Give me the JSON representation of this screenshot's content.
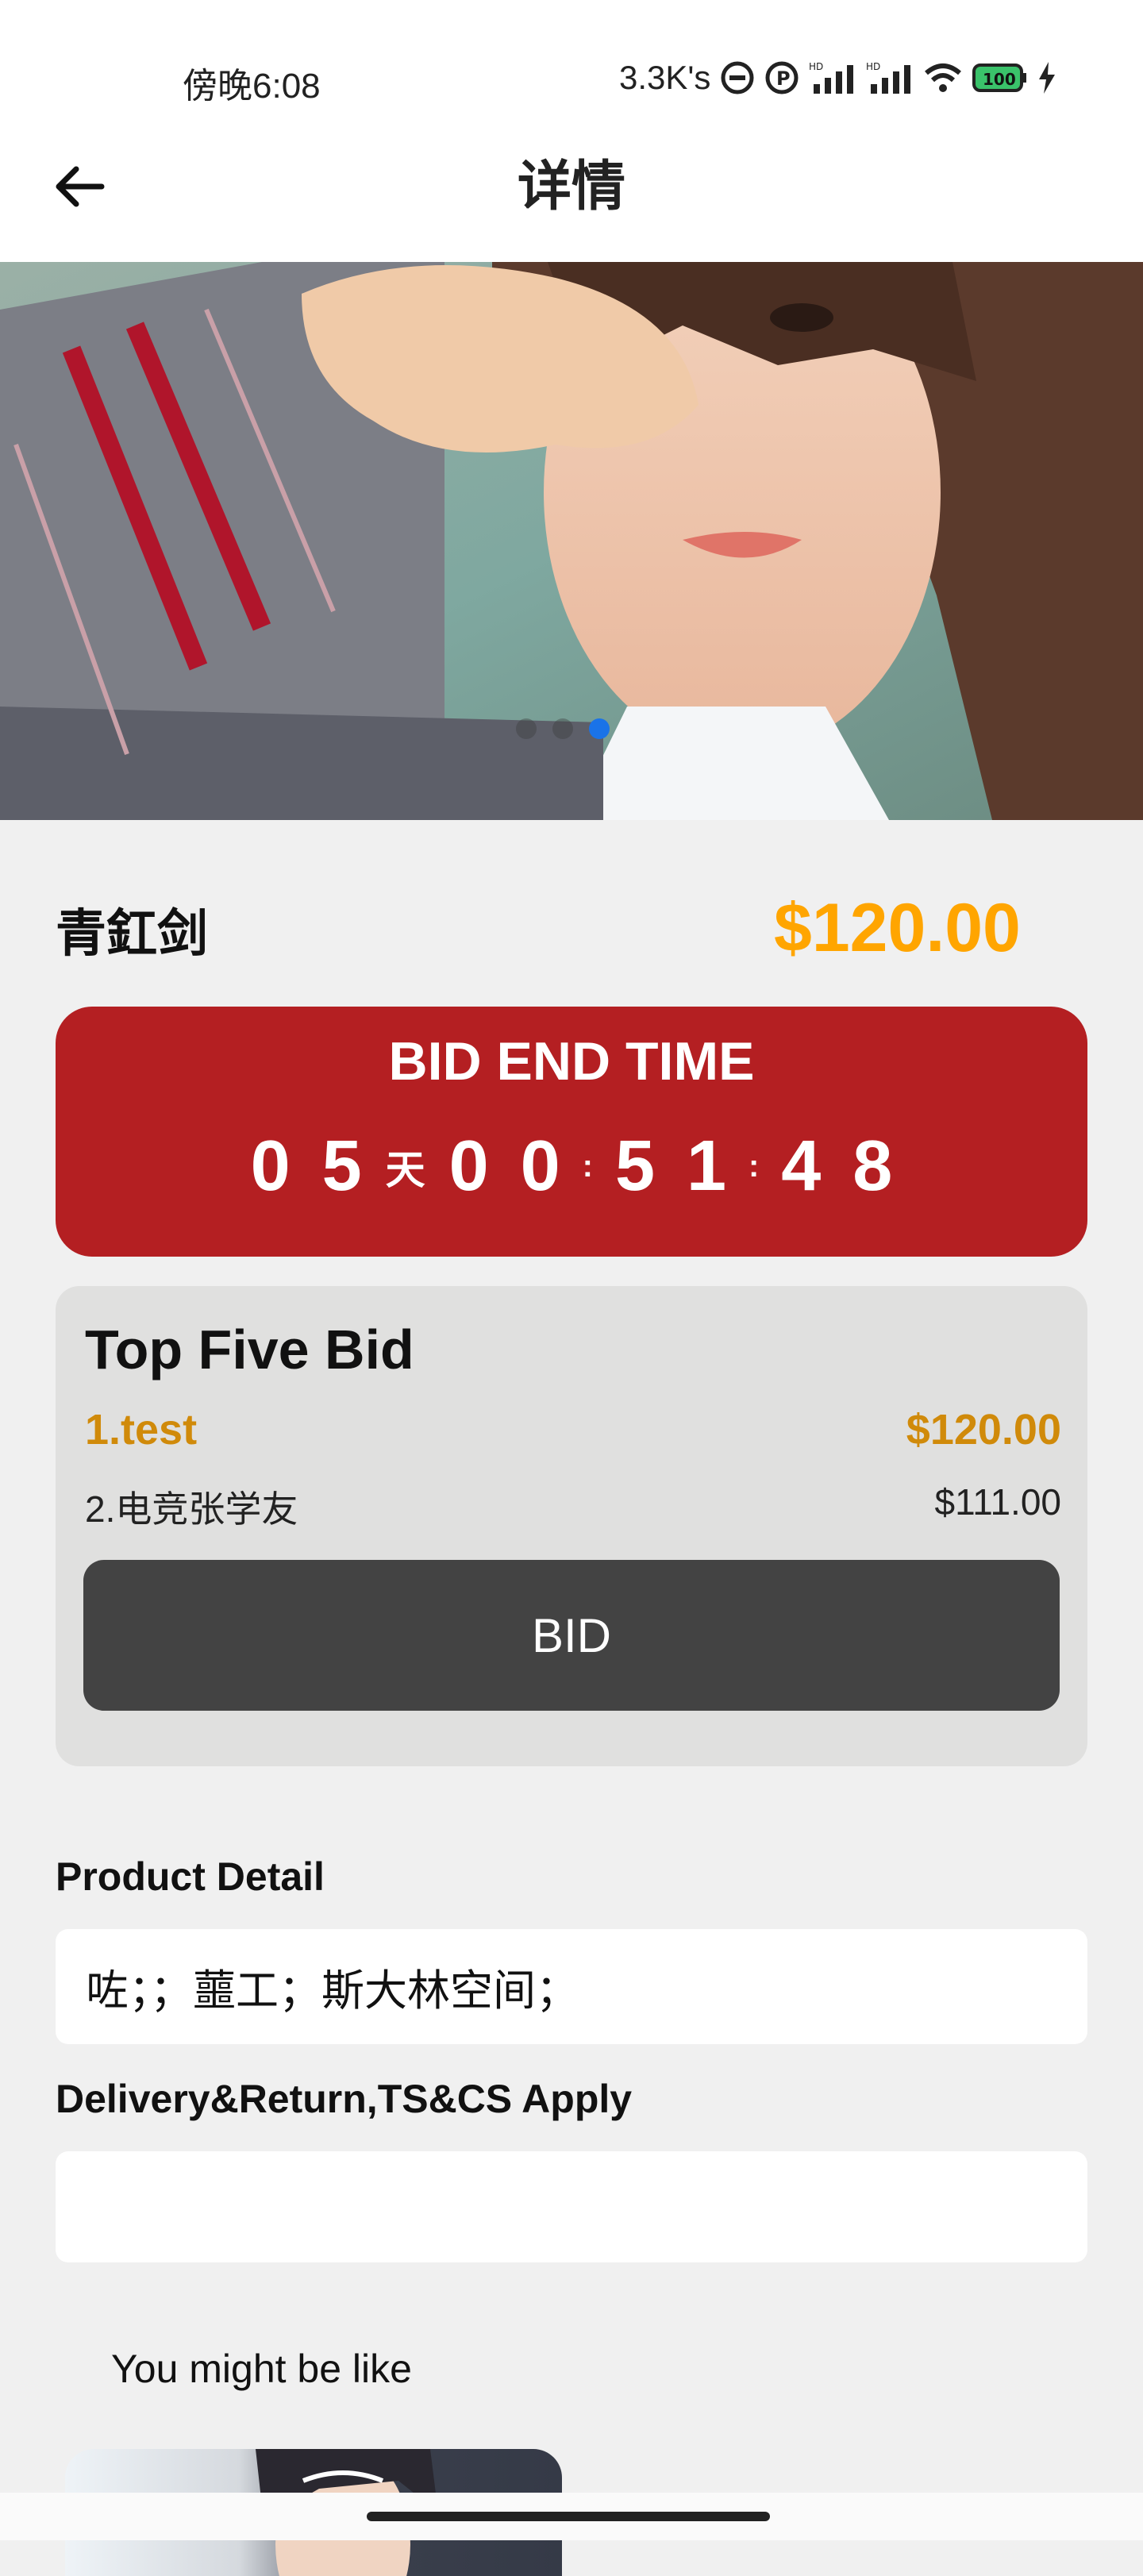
{
  "status_bar": {
    "time": "傍晚6:08",
    "network_speed": "3.3K's",
    "battery": "100"
  },
  "header": {
    "title": "详情"
  },
  "carousel": {
    "active_index": 2,
    "count": 3
  },
  "product": {
    "name": "青釭剑",
    "price": "$120.00"
  },
  "countdown": {
    "title": "BID END TIME",
    "days": [
      "0",
      "5"
    ],
    "day_unit": "天",
    "hours": [
      "0",
      "0"
    ],
    "minutes": [
      "5",
      "1"
    ],
    "seconds": [
      "4",
      "8"
    ],
    "colon": ":"
  },
  "top_five": {
    "title": "Top Five Bid",
    "bids": [
      {
        "name": "1.test",
        "amount": "$120.00"
      },
      {
        "name": "2.电竞张学友",
        "amount": "$111.00"
      }
    ],
    "bid_button": "BID"
  },
  "product_detail": {
    "label": "Product Detail",
    "text": "咗；；蘁工；斯大林空间；"
  },
  "delivery": {
    "label": "Delivery&Return,TS&CS Apply",
    "text": ""
  },
  "recommend": {
    "label": "You might be like"
  },
  "colors": {
    "price": "#ffa500",
    "countdown_bg": "#b41f22",
    "first_bid": "#d08a0a",
    "bid_button": "#434343",
    "active_dot": "#1a73e8"
  }
}
